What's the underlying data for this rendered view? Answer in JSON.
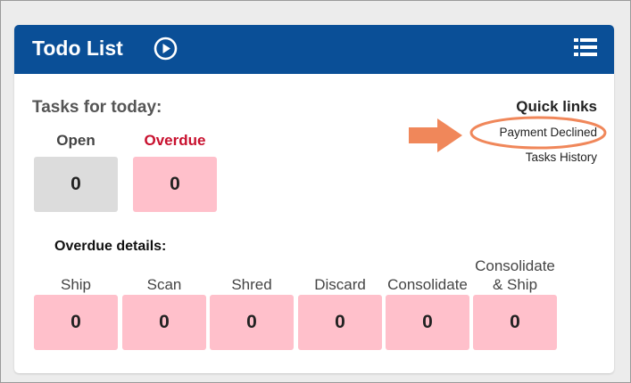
{
  "header": {
    "title": "Todo List"
  },
  "tasks": {
    "title": "Tasks for today:",
    "open": {
      "label": "Open",
      "value": "0"
    },
    "overdue": {
      "label": "Overdue",
      "value": "0"
    }
  },
  "quick_links": {
    "title": "Quick links",
    "items": [
      "Payment Declined",
      "Tasks History"
    ]
  },
  "overdue_details": {
    "title": "Overdue details:",
    "items": [
      {
        "label": "Ship",
        "value": "0"
      },
      {
        "label": "Scan",
        "value": "0"
      },
      {
        "label": "Shred",
        "value": "0"
      },
      {
        "label": "Discard",
        "value": "0"
      },
      {
        "label": "Consolidate",
        "value": "0"
      },
      {
        "label": "Consolidate & Ship",
        "value": "0"
      }
    ]
  },
  "colors": {
    "header_bg": "#0a4f97",
    "overdue_text": "#c8102e",
    "open_box": "#dcdcdc",
    "overdue_box": "#ffc0cb",
    "annotation": "#f0875a"
  }
}
